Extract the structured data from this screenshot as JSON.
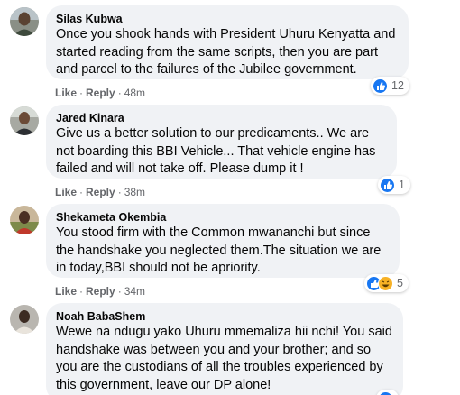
{
  "colors": {
    "bubble": "#f0f2f5",
    "text": "#050505",
    "meta": "#65676b",
    "like": "#1877f2",
    "haha": "#f7b125"
  },
  "comments": [
    {
      "author": "Silas Kubwa",
      "text": "Once you shook hands with President Uhuru Kenyatta and started reading from the same scripts, then you are part and parcel to the failures of the Jubilee government.",
      "like_label": "Like",
      "reply_label": "Reply",
      "time": "48m",
      "reactions": {
        "icons": [
          "like-icon"
        ],
        "count": "12"
      }
    },
    {
      "author": "Jared Kinara",
      "text": "Give us a better solution to our predicaments.. We are not boarding this BBI Vehicle... That vehicle engine has failed and will not take off. Please dump it !",
      "like_label": "Like",
      "reply_label": "Reply",
      "time": "38m",
      "reactions": {
        "icons": [
          "like-icon"
        ],
        "count": "1"
      }
    },
    {
      "author": "Shekameta Okembia",
      "text": "You stood firm with the Common mwananchi but since the handshake you neglected them.The situation we are in today,BBI should not be apriority.",
      "like_label": "Like",
      "reply_label": "Reply",
      "time": "34m",
      "reactions": {
        "icons": [
          "like-icon",
          "haha-icon"
        ],
        "count": "5"
      }
    },
    {
      "author": "Noah BabaShem",
      "text": "Wewe na ndugu yako Uhuru mmemaliza hii nchi! You said handshake was between you and your brother; and so you are the custodians of all the troubles experienced by this government, leave our DP alone!",
      "reactions": {
        "icons": [
          "like-icon"
        ],
        "count": ""
      }
    }
  ]
}
